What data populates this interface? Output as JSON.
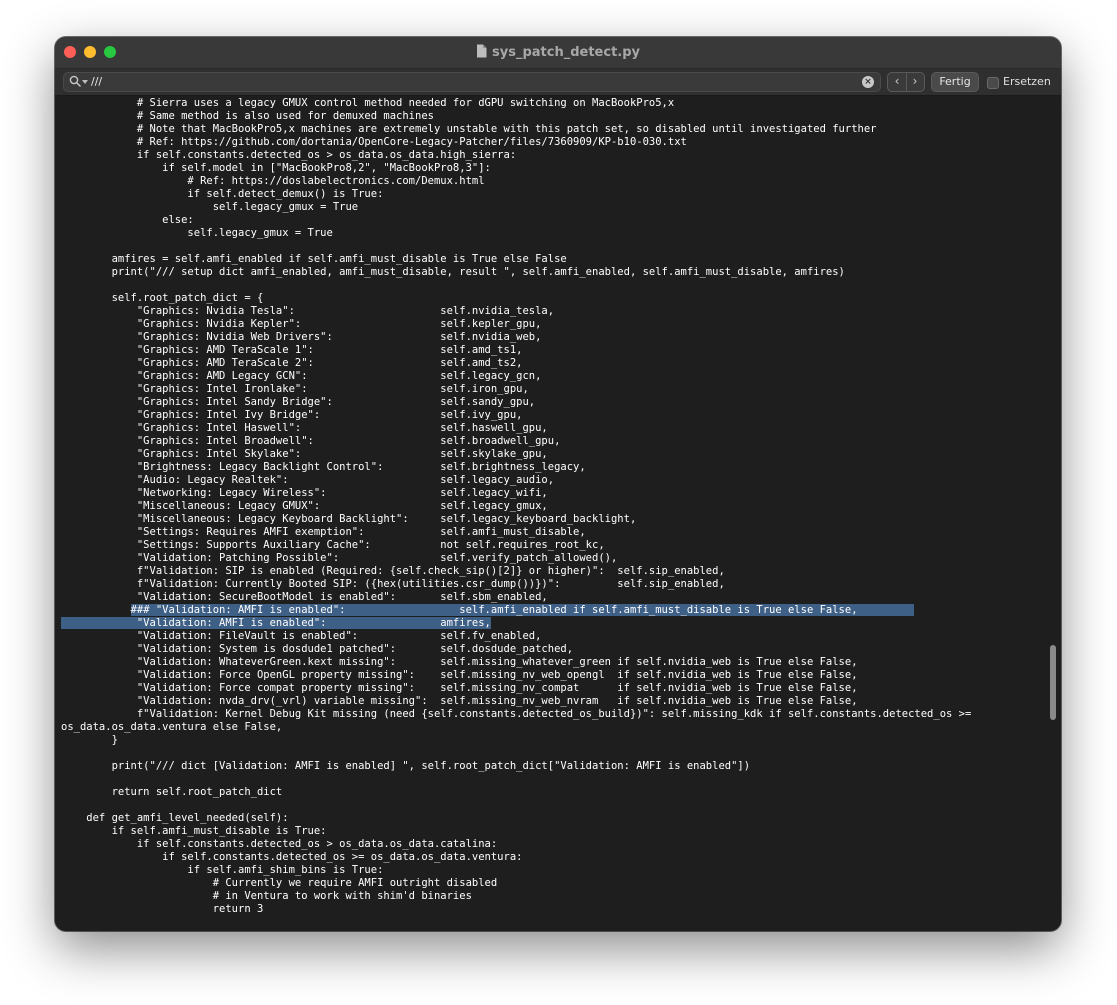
{
  "window": {
    "title": "sys_patch_detect.py",
    "icon": "document-icon"
  },
  "findbar": {
    "query": "///",
    "done_label": "Fertig",
    "replace_label": "Ersetzen",
    "replace_checked": false
  },
  "editor": {
    "highlight_color": "#3e5f86",
    "lines": [
      "            # Sierra uses a legacy GMUX control method needed for dGPU switching on MacBookPro5,x",
      "            # Same method is also used for demuxed machines",
      "            # Note that MacBookPro5,x machines are extremely unstable with this patch set, so disabled until investigated further",
      "            # Ref: https://github.com/dortania/OpenCore-Legacy-Patcher/files/7360909/KP-b10-030.txt",
      "            if self.constants.detected_os > os_data.os_data.high_sierra:",
      "                if self.model in [\"MacBookPro8,2\", \"MacBookPro8,3\"]:",
      "                    # Ref: https://doslabelectronics.com/Demux.html",
      "                    if self.detect_demux() is True:",
      "                        self.legacy_gmux = True",
      "                else:",
      "                    self.legacy_gmux = True",
      "",
      "        amfires = self.amfi_enabled if self.amfi_must_disable is True else False",
      "        print(\"/// setup dict amfi_enabled, amfi_must_disable, result \", self.amfi_enabled, self.amfi_must_disable, amfires)",
      "",
      "        self.root_patch_dict = {",
      "            \"Graphics: Nvidia Tesla\":                       self.nvidia_tesla,",
      "            \"Graphics: Nvidia Kepler\":                      self.kepler_gpu,",
      "            \"Graphics: Nvidia Web Drivers\":                 self.nvidia_web,",
      "            \"Graphics: AMD TeraScale 1\":                    self.amd_ts1,",
      "            \"Graphics: AMD TeraScale 2\":                    self.amd_ts2,",
      "            \"Graphics: AMD Legacy GCN\":                     self.legacy_gcn,",
      "            \"Graphics: Intel Ironlake\":                     self.iron_gpu,",
      "            \"Graphics: Intel Sandy Bridge\":                 self.sandy_gpu,",
      "            \"Graphics: Intel Ivy Bridge\":                   self.ivy_gpu,",
      "            \"Graphics: Intel Haswell\":                      self.haswell_gpu,",
      "            \"Graphics: Intel Broadwell\":                    self.broadwell_gpu,",
      "            \"Graphics: Intel Skylake\":                      self.skylake_gpu,",
      "            \"Brightness: Legacy Backlight Control\":         self.brightness_legacy,",
      "            \"Audio: Legacy Realtek\":                        self.legacy_audio,",
      "            \"Networking: Legacy Wireless\":                  self.legacy_wifi,",
      "            \"Miscellaneous: Legacy GMUX\":                   self.legacy_gmux,",
      "            \"Miscellaneous: Legacy Keyboard Backlight\":     self.legacy_keyboard_backlight,",
      "            \"Settings: Requires AMFI exemption\":            self.amfi_must_disable,",
      "            \"Settings: Supports Auxiliary Cache\":           not self.requires_root_kc,",
      "            \"Validation: Patching Possible\":                self.verify_patch_allowed(),",
      "            f\"Validation: SIP is enabled (Required: {self.check_sip()[2]} or higher)\":  self.sip_enabled,",
      "            f\"Validation: Currently Booted SIP: ({hex(utilities.csr_dump())})\":         self.sip_enabled,",
      "            \"Validation: SecureBootModel is enabled\":       self.sbm_enabled,",
      "           ### \"Validation: AMFI is enabled\":                  self.amfi_enabled if self.amfi_must_disable is True else False,",
      "            \"Validation: AMFI is enabled\":                  amfires,",
      "            \"Validation: FileVault is enabled\":             self.fv_enabled,",
      "            \"Validation: System is dosdude1 patched\":       self.dosdude_patched,",
      "            \"Validation: WhateverGreen.kext missing\":       self.missing_whatever_green if self.nvidia_web is True else False,",
      "            \"Validation: Force OpenGL property missing\":    self.missing_nv_web_opengl  if self.nvidia_web is True else False,",
      "            \"Validation: Force compat property missing\":    self.missing_nv_compat      if self.nvidia_web is True else False,",
      "            \"Validation: nvda_drv(_vrl) variable missing\":  self.missing_nv_web_nvram   if self.nvidia_web is True else False,",
      "            f\"Validation: Kernel Debug Kit missing (need {self.constants.detected_os_build})\": self.missing_kdk if self.constants.detected_os >=",
      "os_data.os_data.ventura else False,",
      "        }",
      "",
      "        print(\"/// dict [Validation: AMFI is enabled] \", self.root_patch_dict[\"Validation: AMFI is enabled\"])",
      "",
      "        return self.root_patch_dict",
      "",
      "    def get_amfi_level_needed(self):",
      "        if self.amfi_must_disable is True:",
      "            if self.constants.detected_os > os_data.os_data.catalina:",
      "                if self.constants.detected_os >= os_data.os_data.ventura:",
      "                    if self.amfi_shim_bins is True:",
      "                        # Currently we require AMFI outright disabled",
      "                        # in Ventura to work with shim'd binaries",
      "                        return 3"
    ]
  }
}
